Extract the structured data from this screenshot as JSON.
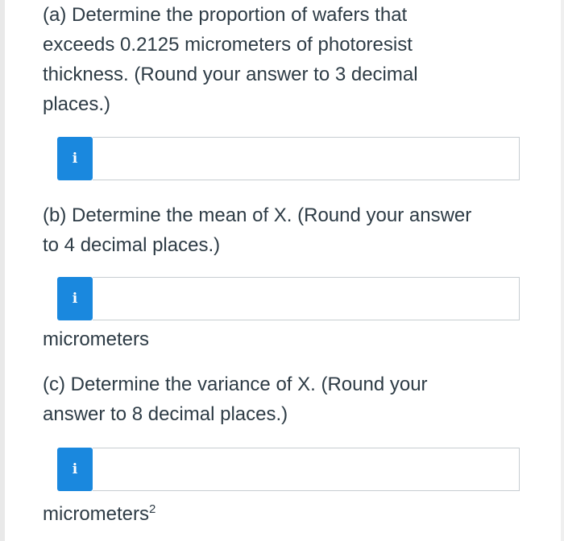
{
  "parts": {
    "a": {
      "lines": [
        "(a) Determine the proportion of wafers that",
        "exceeds 0.2125 micrometers of photoresist",
        "thickness. (Round your answer to 3 decimal",
        "places.)"
      ],
      "input_value": ""
    },
    "b": {
      "lines": [
        "(b) Determine the mean of X. (Round your answer",
        "to 4 decimal places.)"
      ],
      "input_value": "",
      "unit": "micrometers"
    },
    "c": {
      "lines": [
        "(c) Determine the variance of X. (Round your",
        "answer to 8 decimal places.)"
      ],
      "input_value": "",
      "unit": "micrometers",
      "unit_superscript": "2"
    }
  },
  "info_button": {
    "glyph": "i"
  },
  "colors": {
    "info_button": "#1a88de",
    "text": "#2d3b45",
    "input_border": "#c7cdd1"
  }
}
